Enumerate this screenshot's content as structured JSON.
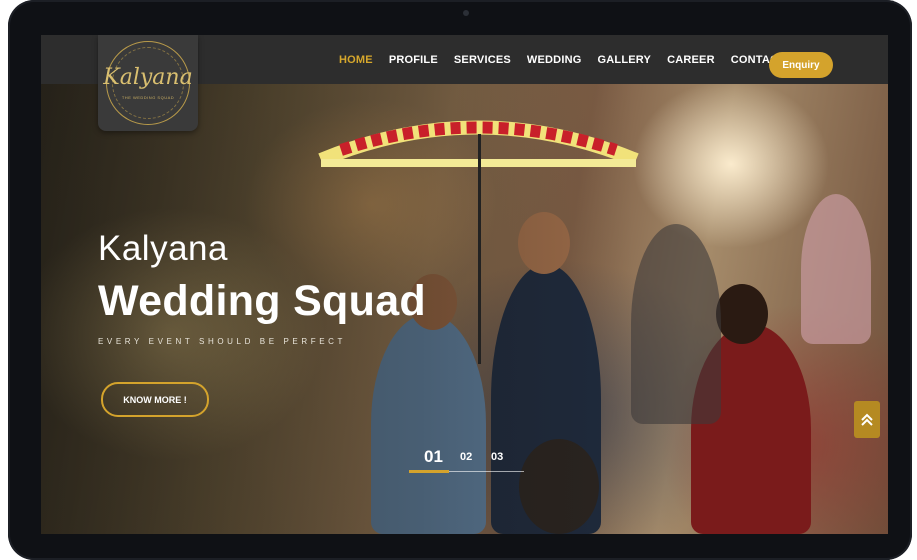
{
  "logo": {
    "text": "Kalyana",
    "sub": "THE WEDDING SQUAD"
  },
  "nav": {
    "items": [
      "HOME",
      "PROFILE",
      "SERVICES",
      "WEDDING",
      "GALLERY",
      "CAREER",
      "CONTACT"
    ],
    "active": "HOME"
  },
  "enquiry_label": "Enquiry",
  "hero": {
    "title_small": "Kalyana",
    "title_big": "Wedding Squad",
    "tagline": "EVERY EVENT SHOULD BE PERFECT",
    "cta_label": "KNOW MORE !"
  },
  "slider": {
    "pages": [
      "01",
      "02",
      "03"
    ],
    "current": "01"
  },
  "colors": {
    "accent": "#d4a32c",
    "navbar": "#2d2d2d",
    "device": "#0f1115"
  },
  "icons": {
    "scroll_top": "double-chevron-up-icon"
  }
}
